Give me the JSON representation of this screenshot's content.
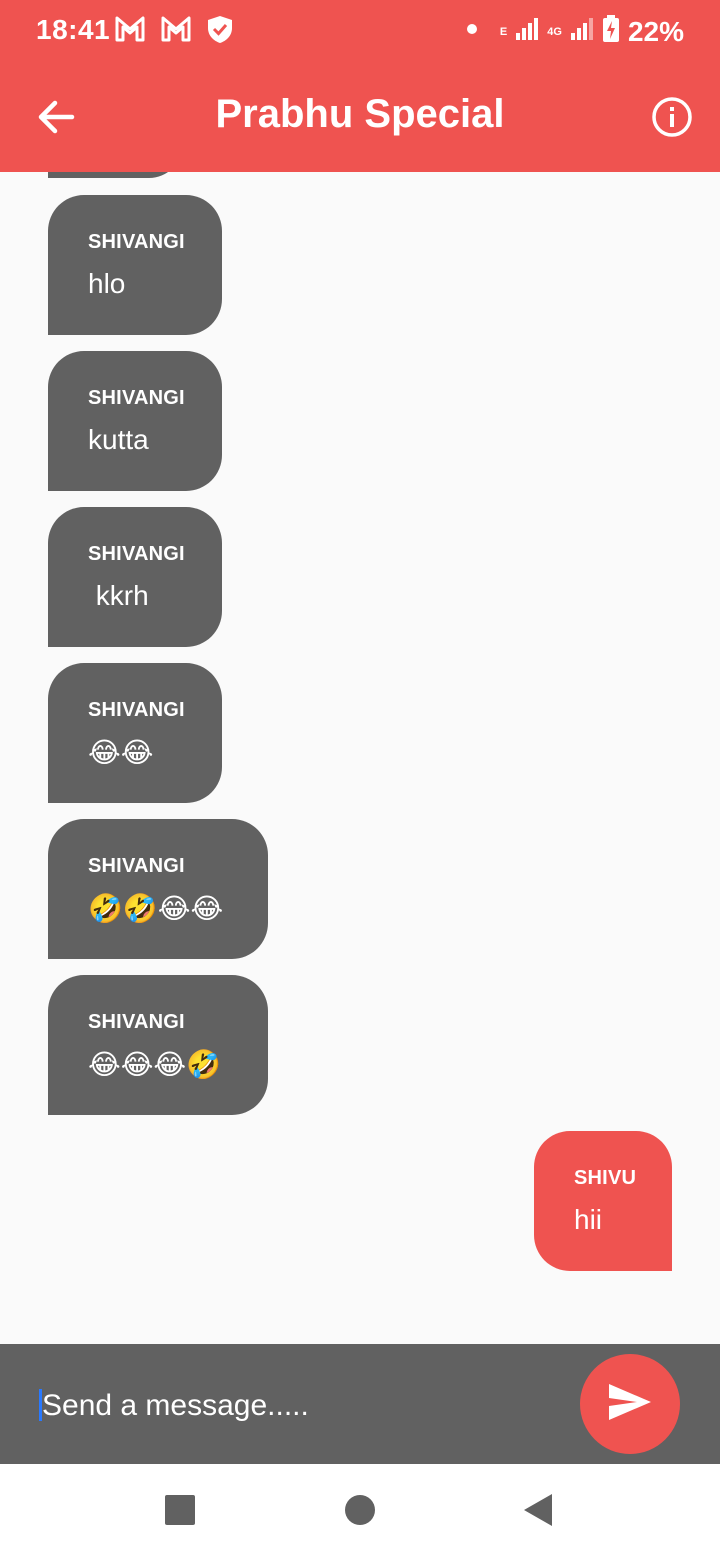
{
  "status_bar": {
    "time": "18:41",
    "battery": "22%",
    "network_label": "4G",
    "network_e": "E",
    "icons": [
      "gmail-icon",
      "gmail-icon",
      "shield-icon",
      "dot-icon",
      "signal-icon",
      "signal-icon",
      "battery-charging-icon"
    ]
  },
  "app_bar": {
    "title": "Prabhu Special",
    "back_icon": "arrow-back-icon",
    "info_icon": "info-icon"
  },
  "messages": [
    {
      "sender": "SHIVANGI",
      "text": "hlo",
      "from_me": false
    },
    {
      "sender": "SHIVANGI",
      "text": "kutta",
      "from_me": false
    },
    {
      "sender": "SHIVANGI",
      "text": " kkrh",
      "from_me": false
    },
    {
      "sender": "SHIVANGI",
      "text": "😂😂",
      "from_me": false
    },
    {
      "sender": "SHIVANGI",
      "text": "🤣🤣😂😂",
      "from_me": false
    },
    {
      "sender": "SHIVANGI",
      "text": "😂😂😂🤣",
      "from_me": false
    },
    {
      "sender": "SHIVU",
      "text": "hii",
      "from_me": true
    }
  ],
  "composer": {
    "placeholder": "Send a message.....",
    "value": "",
    "send_icon": "send-icon"
  },
  "nav_bar": {
    "icons": [
      "recents-square-icon",
      "home-circle-icon",
      "back-triangle-icon"
    ]
  },
  "colors": {
    "accent": "#ef5350",
    "bubble_other": "#616161",
    "background": "#fafafa",
    "composer": "#616161"
  }
}
